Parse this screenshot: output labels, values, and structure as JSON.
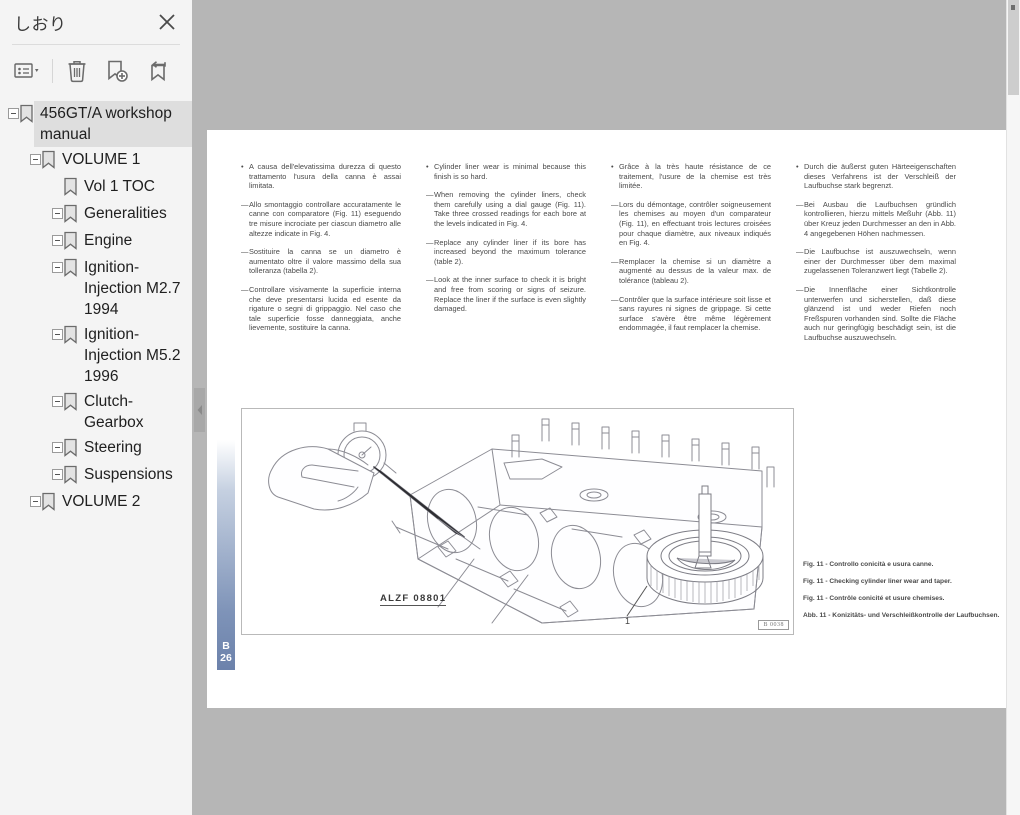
{
  "sidebar": {
    "title": "しおり",
    "close_icon": "close-icon",
    "toolbar": [
      {
        "name": "bookmark-options-dropdown",
        "icon": "list-options-icon"
      },
      {
        "name": "delete-bookmark",
        "icon": "trash-icon"
      },
      {
        "name": "add-bookmark",
        "icon": "bookmark-plus-icon"
      },
      {
        "name": "move-bookmark",
        "icon": "bookmark-arrow-icon"
      }
    ],
    "tree": [
      {
        "label": "456GT/A workshop manual",
        "level": 0,
        "expandable": true,
        "selected": true
      },
      {
        "label": "VOLUME 1",
        "level": 1,
        "expandable": true,
        "selected": false
      },
      {
        "label": "Vol 1 TOC",
        "level": 2,
        "expandable": false,
        "selected": false
      },
      {
        "label": "Generalities",
        "level": 2,
        "expandable": true,
        "selected": false
      },
      {
        "label": "Engine",
        "level": 2,
        "expandable": true,
        "selected": false
      },
      {
        "label": "Ignition-Injection M2.7 1994",
        "level": 2,
        "expandable": true,
        "selected": false
      },
      {
        "label": "Ignition-Injection M5.2 1996",
        "level": 2,
        "expandable": true,
        "selected": false
      },
      {
        "label": "Clutch-Gearbox",
        "level": 2,
        "expandable": true,
        "selected": false
      },
      {
        "label": "Steering",
        "level": 2,
        "expandable": true,
        "selected": false
      },
      {
        "label": "Suspensions",
        "level": 2,
        "expandable": true,
        "selected": false
      },
      {
        "label": "VOLUME 2",
        "level": 1,
        "expandable": true,
        "selected": false
      }
    ]
  },
  "viewer": {
    "page_tab": {
      "letter": "B",
      "number": "26"
    },
    "columns": [
      {
        "lang": "it",
        "paragraphs": [
          {
            "marker": "•",
            "text": "A causa dell'elevatissima durezza di questo trattamento l'usura della canna è assai limitata."
          },
          {
            "marker": "—",
            "text": "Allo smontaggio controllare accuratamente le canne con comparatore (Fig. 11) eseguendo tre misure incrociate per ciascun diametro alle altezze indicate in Fig. 4."
          },
          {
            "marker": "—",
            "text": "Sostituire la canna se un diametro è aumentato oltre il valore massimo della sua tolleranza (tabella 2)."
          },
          {
            "marker": "—",
            "text": "Controllare visivamente la superficie interna che deve presentarsi lucida ed esente da rigature o segni di grippaggio. Nel caso che tale superficie fosse danneggiata, anche lievemente, sostituire la canna."
          }
        ]
      },
      {
        "lang": "en",
        "paragraphs": [
          {
            "marker": "•",
            "text": "Cylinder liner wear is minimal because this finish is so hard."
          },
          {
            "marker": "—",
            "text": "When removing the cylinder liners, check them carefully using a dial gauge (Fig. 11). Take three crossed readings for each bore at the levels indicated in Fig. 4."
          },
          {
            "marker": "—",
            "text": "Replace any cylinder liner if its bore has increased beyond the maximum tolerance (table 2)."
          },
          {
            "marker": "—",
            "text": "Look at the inner surface to check it is bright and free from scoring or signs of seizure. Replace the liner if the surface is even slightly damaged."
          }
        ]
      },
      {
        "lang": "fr",
        "paragraphs": [
          {
            "marker": "•",
            "text": "Grâce à la très haute résistance de ce traitement, l'usure de la chemise est très limitée."
          },
          {
            "marker": "—",
            "text": "Lors du démontage, contrôler soigneusement les chemises au moyen d'un comparateur (Fig. 11), en effectuant trois lectures croisées pour chaque diamètre, aux niveaux indiqués en Fig. 4."
          },
          {
            "marker": "—",
            "text": "Remplacer la chemise si un diamètre a augmenté au dessus de la valeur max. de tolérance (tableau 2)."
          },
          {
            "marker": "—",
            "text": "Contrôler que la surface intérieure soit lisse et sans rayures ni signes de grippage. Si cette surface s'avère être même légèrement endommagée, il faut remplacer la chemise."
          }
        ]
      },
      {
        "lang": "de",
        "paragraphs": [
          {
            "marker": "•",
            "text": "Durch die äußerst guten Härteeigenschaften dieses Verfahrens ist der Verschleiß der Laufbuchse stark begrenzt."
          },
          {
            "marker": "—",
            "text": "Bei Ausbau die Laufbuchsen gründlich kontrollieren, hierzu mittels Meßuhr (Abb. 11) über Kreuz jeden Durchmesser an den in Abb. 4 angegebenen Höhen nachmessen."
          },
          {
            "marker": "—",
            "text": "Die Laufbuchse ist auszuwechseln, wenn einer der Durchmesser über dem maximal zugelassenen Toleranzwert liegt (Tabelle 2)."
          },
          {
            "marker": "—",
            "text": "Die Innenfläche einer Sichtkontrolle unterwerfen und sicherstellen, daß diese glänzend ist und weder Riefen noch Freßspuren vorhanden sind. Sollte die Fläche auch nur geringfügig beschädigt sein, ist die Laufbuchse auszuwechseln."
          }
        ]
      }
    ],
    "figure": {
      "code_label": "ALZF 08801",
      "stamp": "B 0038",
      "captions": [
        "Fig. 11 - Controllo conicità e usura canne.",
        "Fig. 11 - Checking cylinder liner wear and taper.",
        "Fig. 11 - Contrôle conicité et usure chemises.",
        "Abb. 11 - Konizitäts- und Verschleißkontrolle der Laufbuchsen."
      ]
    }
  },
  "colors": {
    "app_background": "#b6b6b6",
    "sidebar_background": "#f4f4f4",
    "selection": "#dedede",
    "page_tab": "#7e93b8"
  }
}
